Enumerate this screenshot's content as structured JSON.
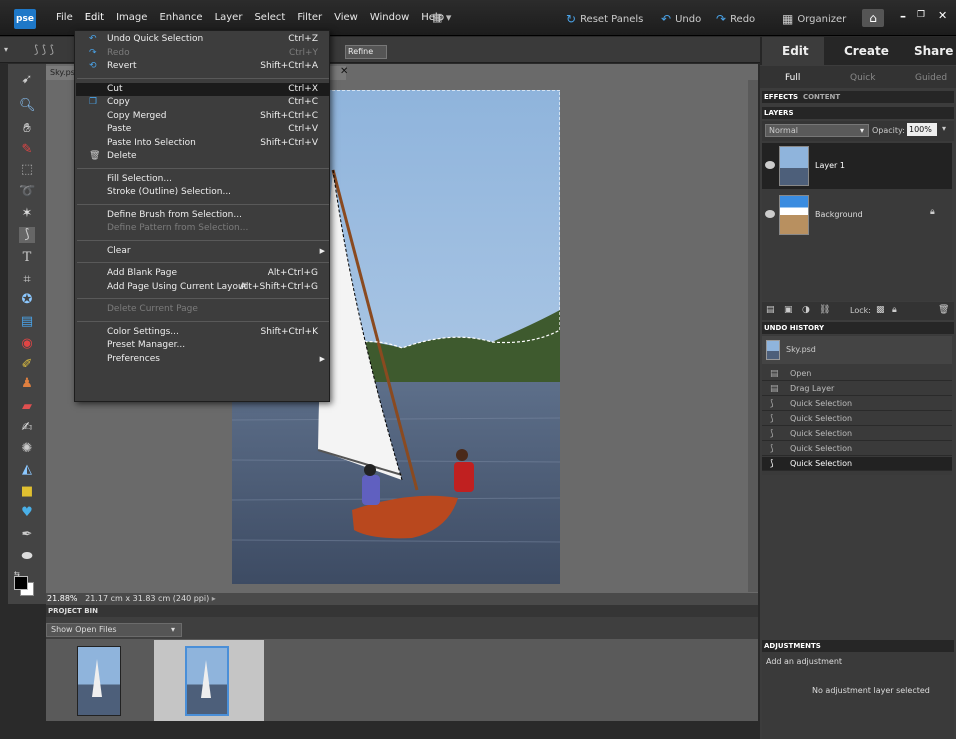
{
  "app": {
    "logo": "pse"
  },
  "menubar": {
    "items": [
      "File",
      "Edit",
      "Image",
      "Enhance",
      "Layer",
      "Select",
      "Filter",
      "View",
      "Window",
      "Help"
    ],
    "active": "Edit",
    "reset_panels": "Reset Panels",
    "undo": "Undo",
    "redo": "Redo",
    "organizer": "Organizer"
  },
  "options": {
    "refine_edge": "Refine Edge..."
  },
  "document": {
    "tab_title": "Sky.psd",
    "zoom": "21.88%",
    "dimensions": "21.17 cm x 31.83 cm (240 ppi)"
  },
  "edit_menu": {
    "items": [
      {
        "label": "Undo Quick Selection",
        "shortcut": "Ctrl+Z",
        "icon": "undo-icon",
        "disabled": false
      },
      {
        "label": "Redo",
        "shortcut": "Ctrl+Y",
        "icon": "redo-icon",
        "disabled": true
      },
      {
        "label": "Revert",
        "shortcut": "Shift+Ctrl+A",
        "icon": "revert-icon",
        "disabled": false
      },
      {
        "sep": true
      },
      {
        "label": "Cut",
        "shortcut": "Ctrl+X",
        "highlighted": true
      },
      {
        "label": "Copy",
        "shortcut": "Ctrl+C",
        "icon": "copy-icon"
      },
      {
        "label": "Copy Merged",
        "shortcut": "Shift+Ctrl+C"
      },
      {
        "label": "Paste",
        "shortcut": "Ctrl+V"
      },
      {
        "label": "Paste Into Selection",
        "shortcut": "Shift+Ctrl+V"
      },
      {
        "label": "Delete",
        "shortcut": "",
        "icon": "trash-icon"
      },
      {
        "sep": true
      },
      {
        "label": "Fill Selection...",
        "shortcut": ""
      },
      {
        "label": "Stroke (Outline) Selection...",
        "shortcut": ""
      },
      {
        "sep": true
      },
      {
        "label": "Define Brush from Selection...",
        "shortcut": ""
      },
      {
        "label": "Define Pattern from Selection...",
        "shortcut": "",
        "disabled": true
      },
      {
        "sep": true
      },
      {
        "label": "Clear",
        "shortcut": "",
        "submenu": true
      },
      {
        "sep": true
      },
      {
        "label": "Add Blank Page",
        "shortcut": "Alt+Ctrl+G"
      },
      {
        "label": "Add Page Using Current Layout",
        "shortcut": "Alt+Shift+Ctrl+G"
      },
      {
        "sep": true
      },
      {
        "label": "Delete Current Page",
        "shortcut": "",
        "disabled": true
      },
      {
        "sep": true
      },
      {
        "label": "Color Settings...",
        "shortcut": "Shift+Ctrl+K"
      },
      {
        "label": "Preset Manager...",
        "shortcut": ""
      },
      {
        "label": "Preferences",
        "shortcut": "",
        "submenu": true
      }
    ]
  },
  "project_bin": {
    "header": "PROJECT BIN",
    "show_select": "Show Open Files"
  },
  "right_panel": {
    "mode_tabs": [
      "Edit",
      "Create",
      "Share"
    ],
    "sub_tabs": [
      "Full",
      "Quick",
      "Guided"
    ],
    "effects_tab": "EFFECTS",
    "content_tab": "CONTENT",
    "layers_header": "LAYERS",
    "blend_mode": "Normal",
    "opacity_label": "Opacity:",
    "opacity_value": "100%",
    "layers": [
      "Layer 1",
      "Background"
    ],
    "lock_label": "Lock:",
    "undo_header": "UNDO HISTORY",
    "undo_snapshot": "Sky.psd",
    "undo_items": [
      "Open",
      "Drag Layer",
      "Quick Selection",
      "Quick Selection",
      "Quick Selection",
      "Quick Selection",
      "Quick Selection"
    ],
    "adjustments_header": "ADJUSTMENTS",
    "add_adjustment": "Add an adjustment",
    "no_adjustment": "No adjustment layer selected"
  },
  "colors": {
    "accent": "#1e78c8",
    "menu_bg": "#3d3d3d",
    "highlight": "#1b1b1b"
  }
}
